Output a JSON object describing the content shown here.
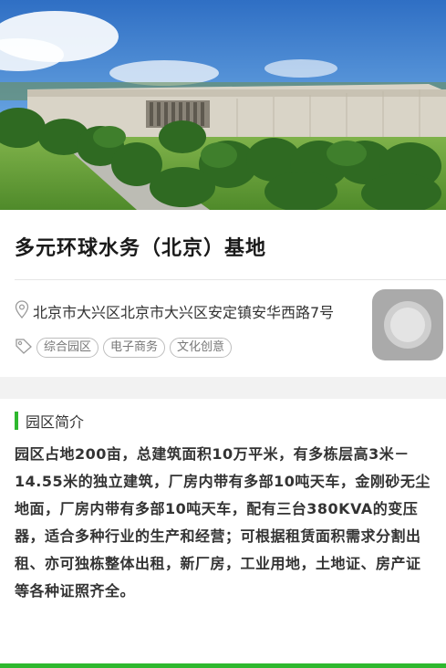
{
  "hero": {
    "icon": "factory-photo"
  },
  "base": {
    "title": "多元环球水务（北京）基地"
  },
  "info": {
    "address": "北京市大兴区北京市大兴区安定镇安华西路7号",
    "tags": [
      "综合园区",
      "电子商务",
      "文化创意"
    ]
  },
  "intro": {
    "section_title": "园区简介",
    "description": "园区占地200亩，总建筑面积10万平米，有多栋层高3米－14.55米的独立建筑，厂房内带有多部10吨天车，金刚砂无尘地面，厂房内带有多部10吨天车，配有三台380KVA的变压器，适合多种行业的生产和经营；可根据租赁面积需求分割出租、亦可独栋整体出租，新厂房，工业用地，土地证、房产证等各种证照齐全。"
  },
  "colors": {
    "accent": "#2eb82e"
  }
}
